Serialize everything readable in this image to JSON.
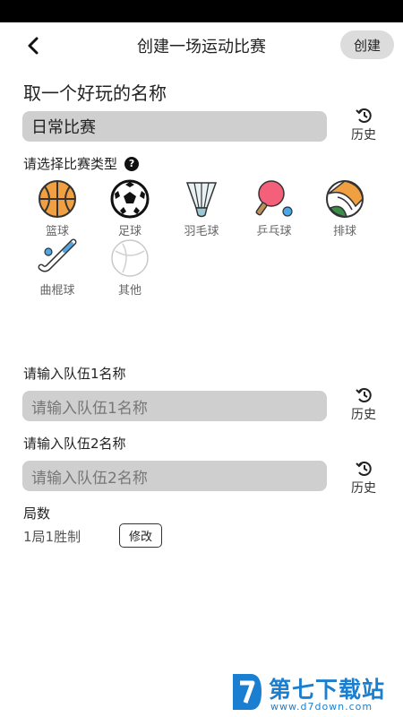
{
  "header": {
    "title": "创建一场运动比赛",
    "create_label": "创建"
  },
  "name_section": {
    "title": "取一个好玩的名称",
    "value": "日常比赛",
    "history_label": "历史"
  },
  "type_section": {
    "label": "请选择比赛类型",
    "sports": [
      {
        "name": "篮球",
        "icon": "basketball-icon"
      },
      {
        "name": "足球",
        "icon": "soccer-ball-icon"
      },
      {
        "name": "羽毛球",
        "icon": "shuttlecock-icon"
      },
      {
        "name": "乒乓球",
        "icon": "ping-pong-icon"
      },
      {
        "name": "排球",
        "icon": "volleyball-icon"
      },
      {
        "name": "曲棍球",
        "icon": "hockey-stick-icon"
      },
      {
        "name": "其他",
        "icon": "other-ball-icon"
      }
    ]
  },
  "team1": {
    "label": "请输入队伍1名称",
    "placeholder": "请输入队伍1名称",
    "history_label": "历史"
  },
  "team2": {
    "label": "请输入队伍2名称",
    "placeholder": "请输入队伍2名称",
    "history_label": "历史"
  },
  "rounds": {
    "label": "局数",
    "value": "1局1胜制",
    "modify_label": "修改"
  },
  "watermark": {
    "title": "第七下载站",
    "url": "www.d7down.com"
  }
}
